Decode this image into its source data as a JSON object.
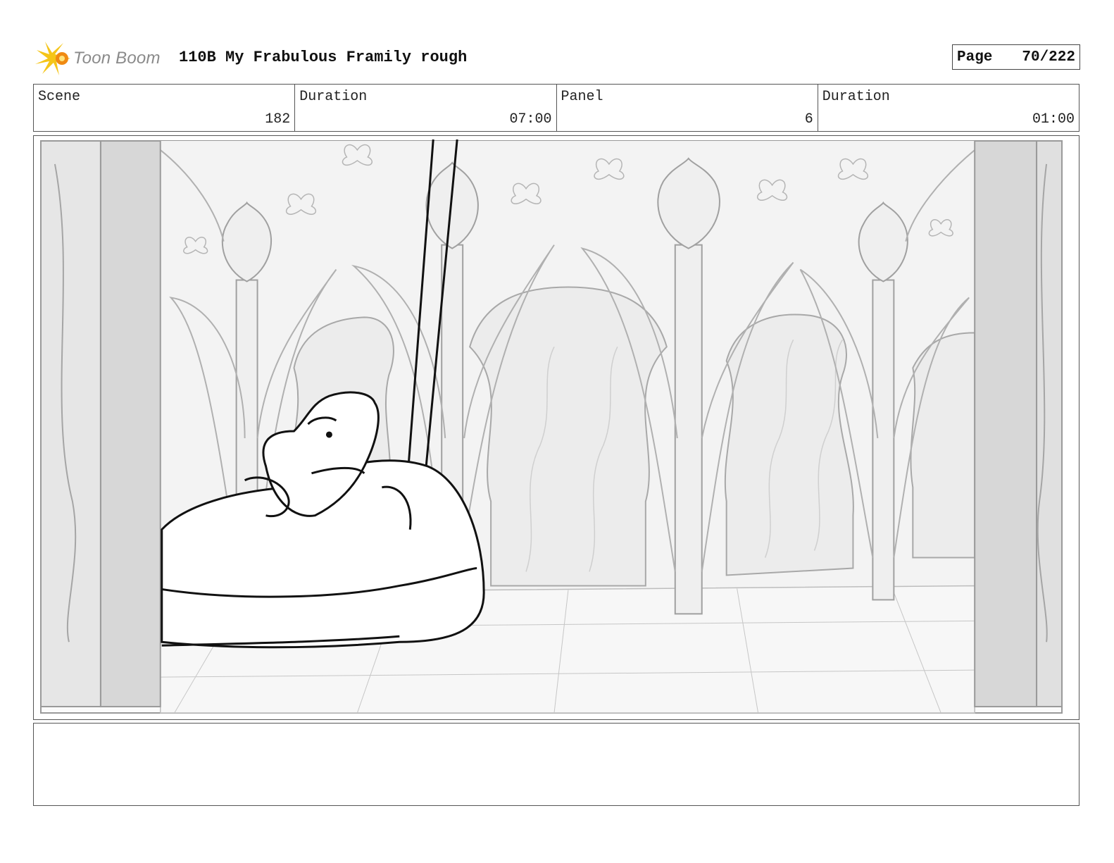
{
  "header": {
    "brand": "Toon Boom",
    "title": "110B My Frabulous Framily rough",
    "page_label": "Page",
    "page_value": "70/222"
  },
  "info": {
    "scene_label": "Scene",
    "scene_value": "182",
    "scene_duration_label": "Duration",
    "scene_duration_value": "07:00",
    "panel_label": "Panel",
    "panel_value": "6",
    "panel_duration_label": "Duration",
    "panel_duration_value": "01:00"
  },
  "colors": {
    "logo_yellow": "#f5c518",
    "logo_orange": "#f08a12",
    "background_lines": "#9a9a9a",
    "character_lines": "#111111"
  }
}
